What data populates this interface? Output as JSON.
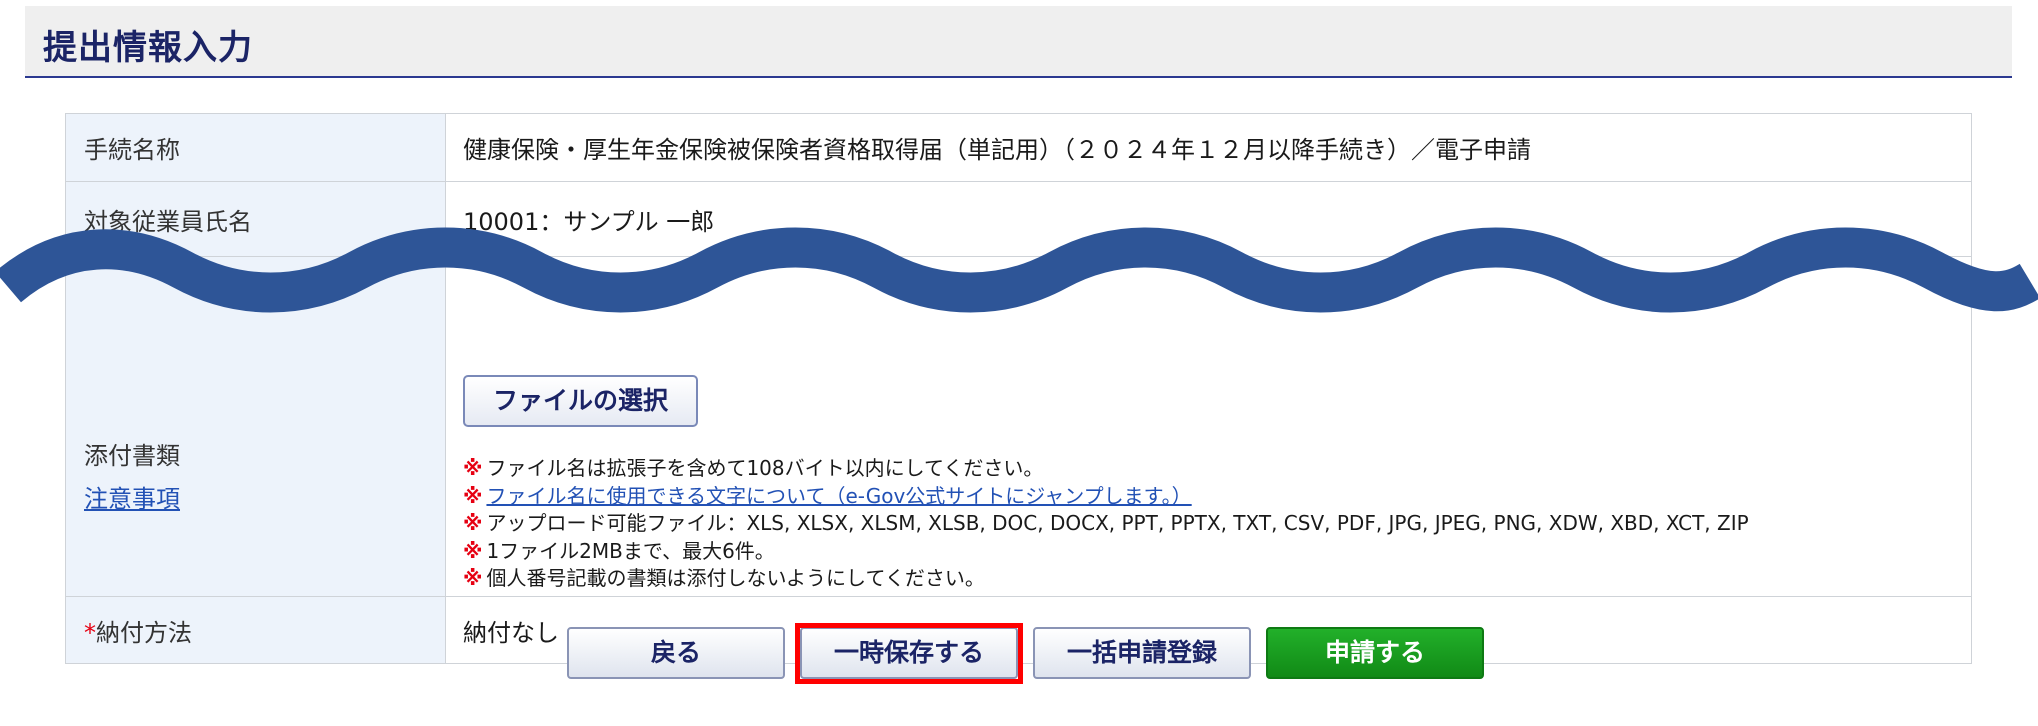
{
  "page": {
    "title": "提出情報入力"
  },
  "form": {
    "procedure": {
      "label": "手続名称",
      "value": "健康保険・厚生年金保険被保険者資格取得届（単記用）（２０２４年１２月以降手続き）／電子申請"
    },
    "employee": {
      "label": "対象従業員氏名",
      "value": "10001：サンプル 一郎"
    },
    "attachment": {
      "label": "添付書類",
      "notice_link": "注意事項",
      "file_button": "ファイルの選択",
      "note_mark": "※",
      "notes": [
        "ファイル名は拡張子を含めて108バイト以内にしてください。",
        "ファイル名に使用できる文字について（e-Gov公式サイトにジャンプします。）",
        "アップロード可能ファイル：XLS, XLSX, XLSM, XLSB, DOC, DOCX, PPT, PPTX, TXT, CSV, PDF, JPG, JPEG, PNG, XDW, XBD, XCT, ZIP",
        "1ファイル2MBまで、最大6件。",
        "個人番号記載の書類は添付しないようにしてください。"
      ]
    },
    "payment": {
      "required_mark": "*",
      "label": "納付方法",
      "value": "納付なし"
    }
  },
  "buttons": {
    "back": "戻る",
    "temp_save": "一時保存する",
    "bulk_register": "一括申請登録",
    "apply": "申請する"
  },
  "colors": {
    "title_text": "#1b2466",
    "title_underline": "#2b3990",
    "label_background": "#edf3fb",
    "link": "#2251b5",
    "note_mark": "#e60012",
    "apply_button": "#1a9e20",
    "highlight": "#ff0000",
    "wave_overlay": "#2e5597"
  }
}
